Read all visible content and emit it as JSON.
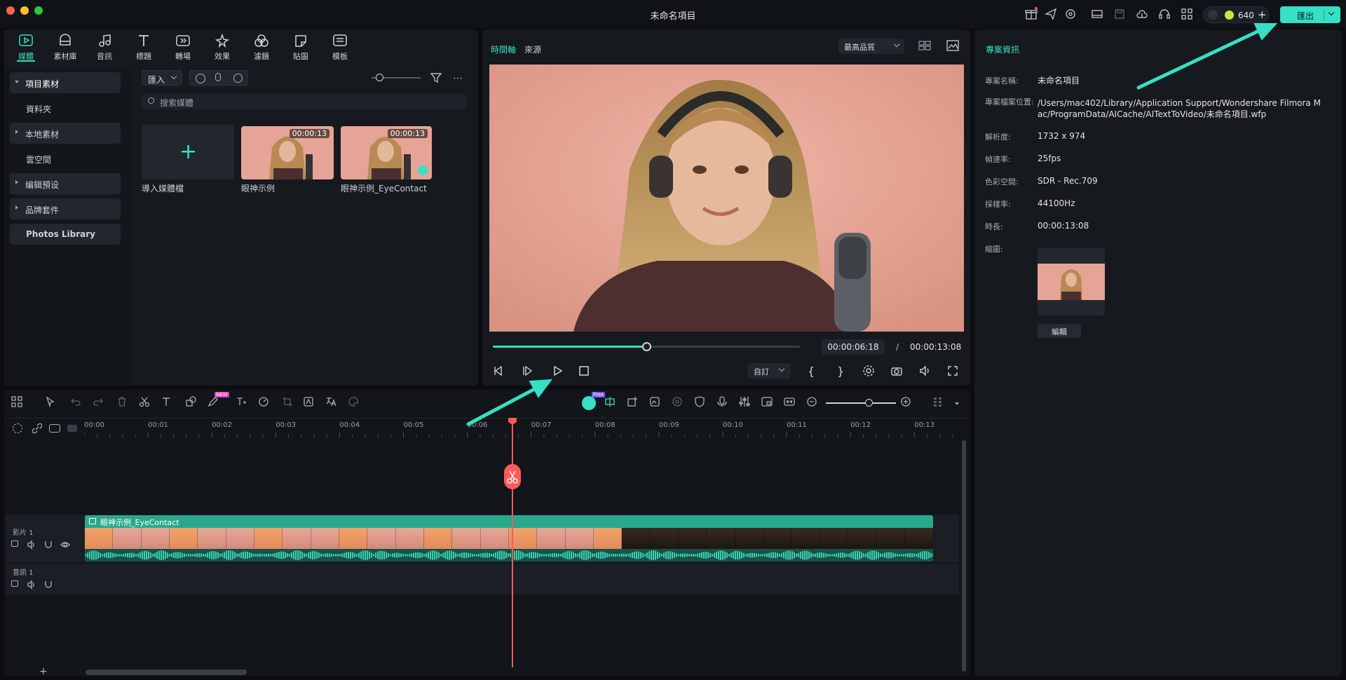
{
  "window": {
    "title": "未命名項目"
  },
  "header": {
    "credits": "640",
    "export_label": "匯出"
  },
  "media_tabs": [
    {
      "label": "媒體",
      "icon": "media-icon"
    },
    {
      "label": "素材庫",
      "icon": "library-icon"
    },
    {
      "label": "音訊",
      "icon": "music-icon"
    },
    {
      "label": "標題",
      "icon": "title-icon"
    },
    {
      "label": "轉場",
      "icon": "transition-icon"
    },
    {
      "label": "效果",
      "icon": "effect-icon"
    },
    {
      "label": "濾鏡",
      "icon": "filter-icon"
    },
    {
      "label": "貼圖",
      "icon": "sticker-icon"
    },
    {
      "label": "模板",
      "icon": "template-icon"
    }
  ],
  "sidebar": {
    "items": [
      {
        "label": "項目素材"
      },
      {
        "label": "資料夾"
      },
      {
        "label": "本地素材"
      },
      {
        "label": "雲空間"
      },
      {
        "label": "编辑預设"
      },
      {
        "label": "品牌套件"
      },
      {
        "label": "Photos Library"
      }
    ]
  },
  "media": {
    "import_label": "匯入",
    "search_placeholder": "搜索媒體",
    "import_media_label": "導入媒體檔",
    "items": [
      {
        "name": "眼神示例",
        "duration": "00:00:13"
      },
      {
        "name": "眼神示例_EyeContact",
        "duration": "00:00:13"
      }
    ]
  },
  "preview": {
    "tab_timeline": "時間軸",
    "tab_source": "來源",
    "quality": "最高品質",
    "current_time": "00:00:06:18",
    "separator": "/",
    "total_time": "00:00:13:08",
    "progress": 0.5,
    "custom_label": "自訂"
  },
  "info": {
    "title": "專案資訊",
    "rows": [
      {
        "label": "專案名稱:",
        "value": "未命名項目"
      },
      {
        "label": "專案檔案位置:",
        "value": "/Users/mac402/Library/Application Support/Wondershare Filmora Mac/ProgramData/AICache/AITextToVideo/未命名項目.wfp"
      },
      {
        "label": "解析度:",
        "value": "1732 x 974"
      },
      {
        "label": "幀速率:",
        "value": "25fps"
      },
      {
        "label": "色彩空間:",
        "value": "SDR - Rec.709"
      },
      {
        "label": "採樣率:",
        "value": "44100Hz"
      },
      {
        "label": "時長:",
        "value": "00:00:13:08"
      },
      {
        "label": "縮圖:",
        "value": ""
      }
    ],
    "edit_label": "編輯"
  },
  "timeline": {
    "ruler": [
      "00:00",
      "00:01",
      "00:02",
      "00:03",
      "00:04",
      "00:05",
      "00:06",
      "00:07",
      "00:08",
      "00:09",
      "00:10",
      "00:11",
      "00:12",
      "00:13"
    ],
    "video_track": "影片 1",
    "audio_track": "音訊 1",
    "clip_name": "眼神示例_EyeContact",
    "badge_new": "NEW",
    "badge_free": "Free",
    "add_label": "+"
  },
  "colors": {
    "accent": "#35e0c5",
    "playhead": "#ff5a5a",
    "clip": "#2aa88d"
  }
}
